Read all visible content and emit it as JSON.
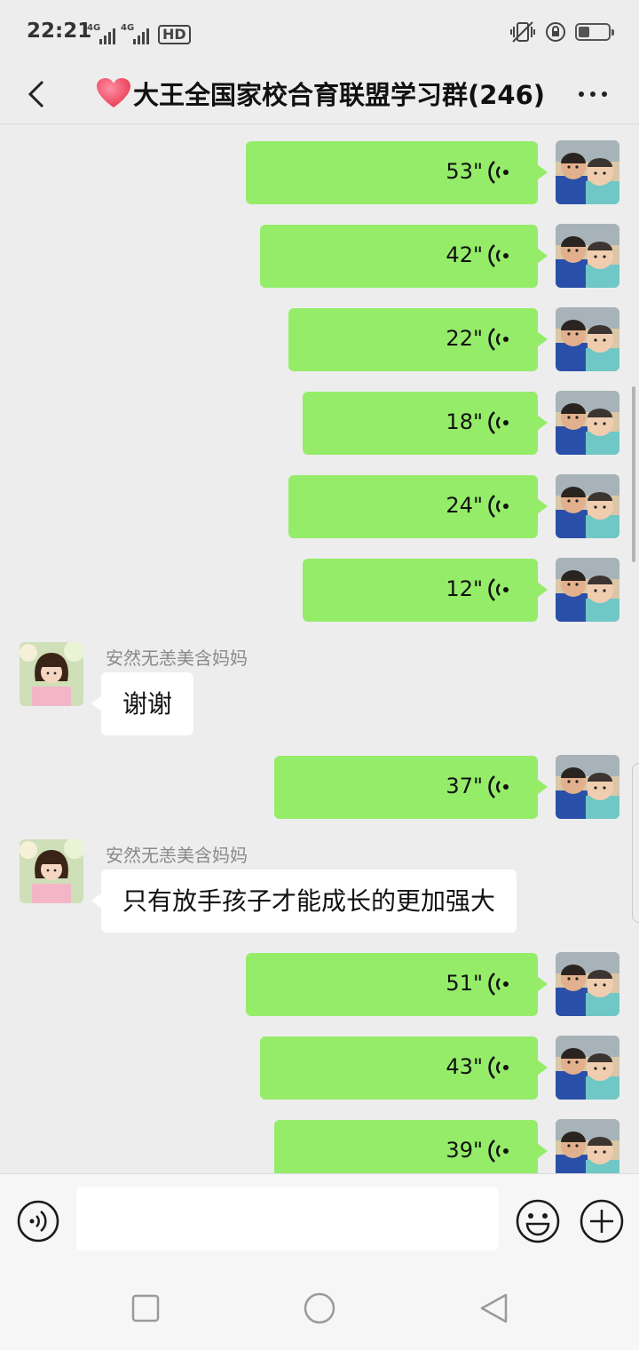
{
  "status_bar": {
    "time": "22:21",
    "network_1": "4G",
    "network_2": "4G",
    "hd_badge": "HD"
  },
  "header": {
    "title": "大王全国家校合育联盟学习群(246)",
    "title_prefix_icon": "heart-icon",
    "back_icon": "chevron-left-icon",
    "more_icon": "more-dots-icon"
  },
  "messages": [
    {
      "type": "voice",
      "side": "right",
      "duration": "53\""
    },
    {
      "type": "voice",
      "side": "right",
      "duration": "42\""
    },
    {
      "type": "voice",
      "side": "right",
      "duration": "22\""
    },
    {
      "type": "voice",
      "side": "right",
      "duration": "18\""
    },
    {
      "type": "voice",
      "side": "right",
      "duration": "24\""
    },
    {
      "type": "voice",
      "side": "right",
      "duration": "12\""
    },
    {
      "type": "text",
      "side": "left",
      "sender": "安然无恙美含妈妈",
      "text": "谢谢"
    },
    {
      "type": "voice",
      "side": "right",
      "duration": "37\""
    },
    {
      "type": "text",
      "side": "left",
      "sender": "安然无恙美含妈妈",
      "text": "只有放手孩子才能成长的更加强大"
    },
    {
      "type": "voice",
      "side": "right",
      "duration": "51\""
    },
    {
      "type": "voice",
      "side": "right",
      "duration": "43\""
    },
    {
      "type": "voice",
      "side": "right",
      "duration": "39\""
    }
  ],
  "input_bar": {
    "text_value": "",
    "voice_icon": "voice-mode-icon",
    "emoji_icon": "emoji-icon",
    "plus_icon": "plus-icon"
  },
  "system_nav": {
    "recent_icon": "square-icon",
    "home_icon": "circle-icon",
    "back_icon": "triangle-back-icon"
  },
  "colors": {
    "background": "#ededed",
    "outgoing_bubble": "#95ec69",
    "incoming_bubble": "#ffffff",
    "sender_name": "#8a8a8a"
  }
}
